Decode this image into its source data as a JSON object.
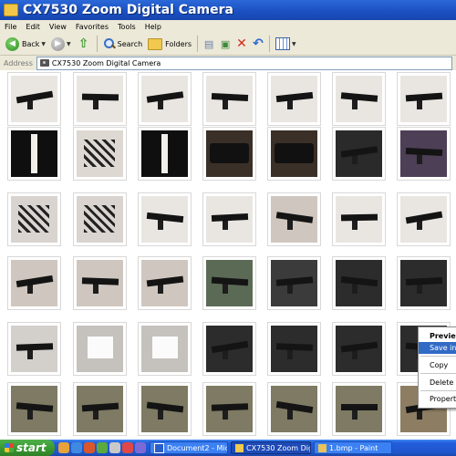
{
  "window": {
    "title": "CX7530 Zoom Digital Camera"
  },
  "menu": [
    "File",
    "Edit",
    "View",
    "Favorites",
    "Tools",
    "Help"
  ],
  "toolbar": {
    "back_label": "Back",
    "search_label": "Search",
    "folders_label": "Folders"
  },
  "address": {
    "label": "Address",
    "value": "CX7530 Zoom Digital Camera"
  },
  "thumbnails": {
    "rows": [
      [
        "rifle on white",
        "rifle on white",
        "rifle on white",
        "rifle on white",
        "rifle on white",
        "rifle on white",
        "rifle on white"
      ],
      [
        "rifle vertical dark",
        "parts on white",
        "rifle vertical dark",
        "rifle case",
        "rifle case",
        "scope dark",
        "rifle on purple"
      ],
      [
        "parts spread",
        "parts spread",
        "rifle on white",
        "rifle on white",
        "rifle close",
        "rifle on white",
        "rifle on white"
      ],
      [
        "rifle close",
        "rifle close",
        "rifle close",
        "items on mat",
        "rifle close dark",
        "rifle dark",
        "rifle dark"
      ],
      [
        "rifle with papers",
        "white square",
        "white square",
        "rifle dark",
        "rifle dark",
        "rifle dark",
        "rifle dark"
      ],
      [
        "rifle on camo",
        "rifle on camo",
        "rifle on camo",
        "rifle on camo",
        "rifle on camo",
        "rifle on camo",
        "items on camo"
      ]
    ]
  },
  "context_menu": {
    "items": [
      "Preview",
      "Save in F",
      "Copy",
      "Delete",
      "Properties"
    ]
  },
  "taskbar": {
    "start_label": "start",
    "tasks": [
      "Document2 - Micr...",
      "CX7530 Zoom Dig...",
      "1.bmp - Paint"
    ]
  },
  "colors": {
    "titlebar": "#1a4fc0",
    "taskbar": "#245edb",
    "start": "#3a9a32",
    "menu_highlight": "#316ac5"
  }
}
